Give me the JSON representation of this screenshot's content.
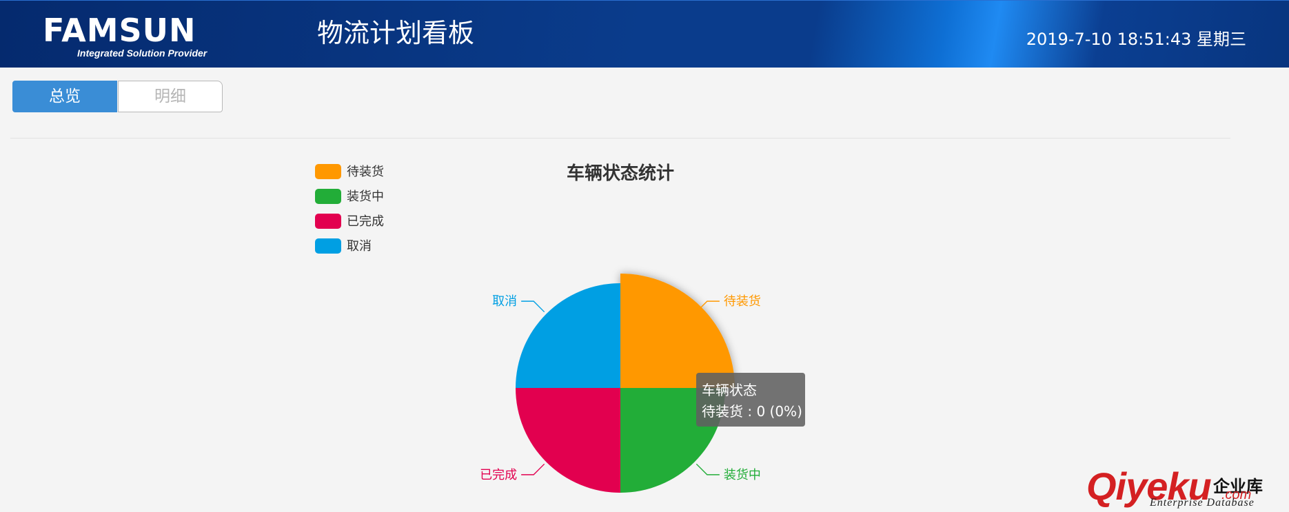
{
  "header": {
    "brand": "FAMSUN",
    "tagline": "Integrated Solution Provider",
    "page_title": "物流计划看板",
    "datetime": "2019-7-10 18:51:43 星期三"
  },
  "tabs": [
    {
      "label": "总览",
      "active": true
    },
    {
      "label": "明细",
      "active": false
    }
  ],
  "chart_data": {
    "type": "pie",
    "title": "车辆状态统计",
    "series_name": "车辆状态",
    "categories": [
      "待装货",
      "装货中",
      "已完成",
      "取消"
    ],
    "values": [
      0,
      0,
      0,
      0
    ],
    "colors": [
      "#ff9800",
      "#22ad38",
      "#e2004f",
      "#009fe3"
    ],
    "legend_position": "top-left",
    "highlighted": "待装货"
  },
  "tooltip": {
    "title": "车辆状态",
    "value_text": "待装货 : 0 (0%)"
  },
  "watermark": {
    "main": "Qiyeku",
    "cn": "企业库",
    "com": ".com",
    "sub": "Enterprise Database"
  }
}
